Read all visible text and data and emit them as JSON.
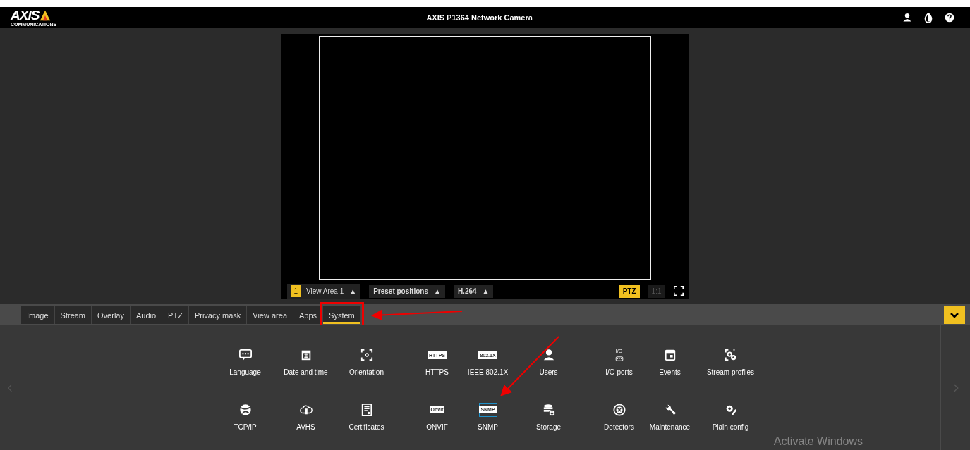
{
  "header": {
    "logo_text": "AXIS",
    "logo_subtext": "COMMUNICATIONS",
    "title": "AXIS P1364 Network Camera"
  },
  "video": {
    "view_badge": "1",
    "view_area": "View Area 1",
    "view_arrow": "▲",
    "preset": "Preset positions",
    "preset_arrow": "▲",
    "codec": "H.264",
    "codec_arrow": "▲",
    "ptz": {
      "label": "PTZ",
      "on": true
    },
    "ratio": {
      "label": "1:1",
      "disabled": true
    }
  },
  "tabs": [
    {
      "label": "Image",
      "selected": false
    },
    {
      "label": "Stream",
      "selected": false
    },
    {
      "label": "Overlay",
      "selected": false
    },
    {
      "label": "Audio",
      "selected": false
    },
    {
      "label": "PTZ",
      "selected": false
    },
    {
      "label": "Privacy mask",
      "selected": false
    },
    {
      "label": "View area",
      "selected": false
    },
    {
      "label": "Apps",
      "selected": false
    },
    {
      "label": "System",
      "selected": true
    }
  ],
  "settings": [
    {
      "label": "Language",
      "selected": false
    },
    {
      "label": "Date and time",
      "selected": false
    },
    {
      "label": "Orientation",
      "selected": false
    },
    {
      "label": "HTTPS",
      "icon_text": "HTTPS",
      "selected": false
    },
    {
      "label": "IEEE 802.1X",
      "icon_text": "802.1X",
      "selected": false
    },
    {
      "label": "Users",
      "selected": false
    },
    {
      "label": "I/O ports",
      "icon_text": "I/O",
      "selected": false
    },
    {
      "label": "Events",
      "selected": false
    },
    {
      "label": "Stream profiles",
      "selected": false
    },
    {
      "label": "TCP/IP",
      "selected": false
    },
    {
      "label": "AVHS",
      "selected": false
    },
    {
      "label": "Certificates",
      "selected": false
    },
    {
      "label": "ONVIF",
      "icon_text": "Onvif",
      "selected": false
    },
    {
      "label": "SNMP",
      "icon_text": "SNMP",
      "selected": true
    },
    {
      "label": "Storage",
      "selected": false
    },
    {
      "label": "Detectors",
      "selected": false
    },
    {
      "label": "Maintenance",
      "selected": false
    },
    {
      "label": "Plain config",
      "selected": false
    }
  ],
  "os_notice": "Activate Windows"
}
